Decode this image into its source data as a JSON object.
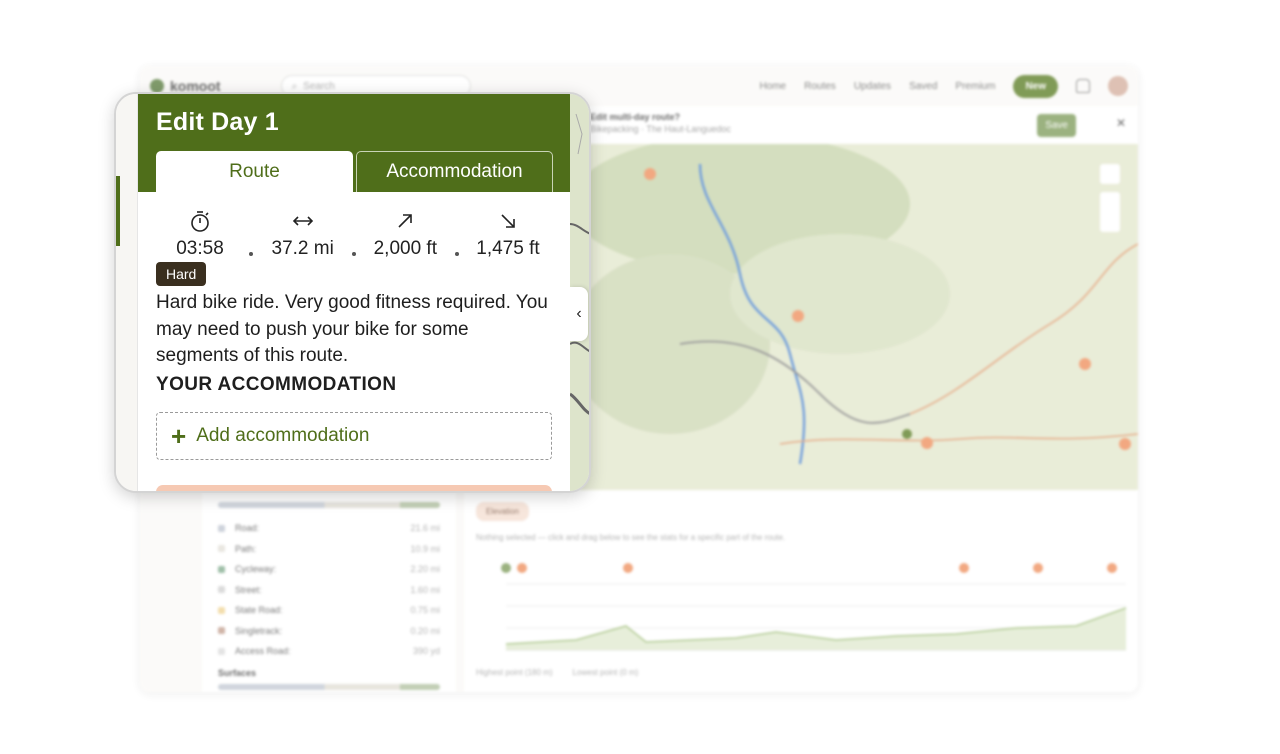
{
  "background": {
    "logo": "komoot",
    "search_placeholder": "Search",
    "nav": [
      "Home",
      "Routes",
      "Updates",
      "Saved",
      "Premium"
    ],
    "new_button": "New",
    "topbar_title": "Edit multi-day route?",
    "topbar_sub": "Bikepacking · The Haut-Languedoc",
    "save_button": "Save",
    "surfaces_rows": [
      {
        "label": "Road:",
        "value": "21.6 mi",
        "color": "#c6ccd6"
      },
      {
        "label": "Path:",
        "value": "10.9 mi",
        "color": "#e6e3dc"
      },
      {
        "label": "Cycleway:",
        "value": "2.20 mi",
        "color": "#8fb59a"
      },
      {
        "label": "Street:",
        "value": "1.60 mi",
        "color": "#d6d6d6"
      },
      {
        "label": "State Road:",
        "value": "0.75 mi",
        "color": "#f2d9a0"
      },
      {
        "label": "Singletrack:",
        "value": "0.20 mi",
        "color": "#c9a99a"
      },
      {
        "label": "Access Road:",
        "value": "390 yd",
        "color": "#e0e0e0"
      }
    ],
    "surfaces_title": "Surfaces",
    "elevation_pill": "Elevation",
    "elevation_hint": "Nothing selected — click and drag below to see the stats for a specific part of the route.",
    "elevation_legend": [
      "Highest point (180 m)",
      "Lowest point (0 m)"
    ]
  },
  "panel": {
    "title": "Edit Day 1",
    "tabs": {
      "route": "Route",
      "accommodation": "Accommodation"
    },
    "stats": {
      "duration": "03:58",
      "distance": "37.2 mi",
      "uphill": "2,000 ft",
      "downhill": "1,475 ft"
    },
    "difficulty": "Hard",
    "description": "Hard bike ride. Very good fitness required. You may need to push your bike for some segments of this route.",
    "accommodation_title": "YOUR ACCOMMODATION",
    "add_accommodation": "Add accommodation"
  },
  "colors": {
    "brand_green": "#4f6e1a",
    "badge_brown": "#3a2f1f",
    "route_blue": "#5b8fd6"
  }
}
